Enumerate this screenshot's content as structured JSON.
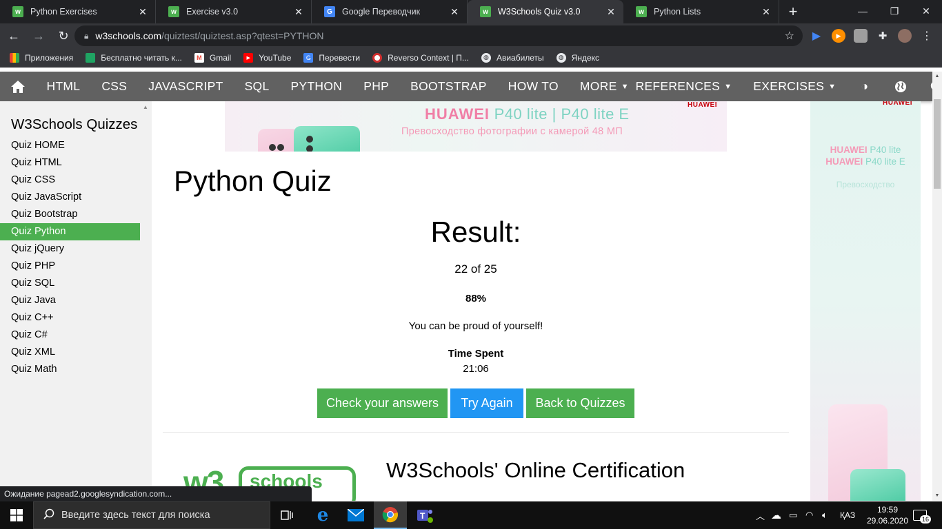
{
  "browser": {
    "tabs": [
      {
        "title": "Python Exercises",
        "icon": "w3",
        "active": false
      },
      {
        "title": "Exercise v3.0",
        "icon": "w3",
        "active": false
      },
      {
        "title": "Google Переводчик",
        "icon": "gt",
        "active": false
      },
      {
        "title": "W3Schools Quiz v3.0",
        "icon": "w3",
        "active": true
      },
      {
        "title": "Python Lists",
        "icon": "w3",
        "active": false
      }
    ],
    "url_host": "w3schools.com",
    "url_path": "/quiztest/quiztest.asp?qtest=PYTHON",
    "bookmarks": [
      {
        "label": "Приложения",
        "icon": "apps-grid-icon",
        "color": "#ea4335"
      },
      {
        "label": "Бесплатно читать к...",
        "icon": "book-icon",
        "color": "#1fa463"
      },
      {
        "label": "Gmail",
        "icon": "gmail-icon",
        "color": "#ea4335"
      },
      {
        "label": "YouTube",
        "icon": "youtube-icon",
        "color": "#ff0000"
      },
      {
        "label": "Перевести",
        "icon": "translate-icon",
        "color": "#4285f4"
      },
      {
        "label": "Reverso Context | П...",
        "icon": "reverso-icon",
        "color": "#d32f2f"
      },
      {
        "label": "Авиабилеты",
        "icon": "globe-icon",
        "color": "#9e9e9e"
      },
      {
        "label": "Яндекс",
        "icon": "globe-icon",
        "color": "#9e9e9e"
      }
    ],
    "status_text": "Ожидание pagead2.googlesyndication.com..."
  },
  "w3nav": {
    "items": [
      "HTML",
      "CSS",
      "JAVASCRIPT",
      "SQL",
      "PYTHON",
      "PHP",
      "BOOTSTRAP",
      "HOW TO",
      "MORE"
    ],
    "references": "REFERENCES",
    "exercises": "EXERCISES"
  },
  "sidebar": {
    "title": "W3Schools Quizzes",
    "links": [
      {
        "label": "Quiz HOME",
        "active": false
      },
      {
        "label": "Quiz HTML",
        "active": false
      },
      {
        "label": "Quiz CSS",
        "active": false
      },
      {
        "label": "Quiz JavaScript",
        "active": false
      },
      {
        "label": "Quiz Bootstrap",
        "active": false
      },
      {
        "label": "Quiz Python",
        "active": true
      },
      {
        "label": "Quiz jQuery",
        "active": false
      },
      {
        "label": "Quiz PHP",
        "active": false
      },
      {
        "label": "Quiz SQL",
        "active": false
      },
      {
        "label": "Quiz Java",
        "active": false
      },
      {
        "label": "Quiz C++",
        "active": false
      },
      {
        "label": "Quiz C#",
        "active": false
      },
      {
        "label": "Quiz XML",
        "active": false
      },
      {
        "label": "Quiz Math",
        "active": false
      }
    ]
  },
  "ad_top": {
    "brand": "HUAWEI",
    "line1_a": "HUAWEI",
    "line1_b": "P40 lite | P40 lite E",
    "line2": "Превосходство фотографии с камерой 48 МП"
  },
  "ad_right": {
    "brand": "HUAWEI",
    "line1_a": "HUAWEI",
    "line1_b": "P40 lite",
    "line2_a": "HUAWEI",
    "line2_b": "P40 lite E",
    "line3": "Превосходство"
  },
  "quiz": {
    "title": "Python Quiz",
    "result_heading": "Result:",
    "score_text": "22 of 25",
    "percent": "88%",
    "message": "You can be proud of yourself!",
    "time_label": "Time Spent",
    "time_value": "21:06",
    "buttons": {
      "check": "Check your answers",
      "retry": "Try Again",
      "back": "Back to Quizzes"
    }
  },
  "certification": {
    "heading": "W3Schools' Online Certification",
    "logo_w3": "w3",
    "logo_schools": "schools"
  },
  "taskbar": {
    "search_placeholder": "Введите здесь текст для поиска",
    "lang": "ҚАЗ",
    "time": "19:59",
    "date": "29.06.2020",
    "notifications": "16"
  },
  "colors": {
    "w3_green": "#4caf50",
    "w3_blue": "#2196f3",
    "w3_nav": "#616161",
    "chrome_dark": "#202124"
  }
}
